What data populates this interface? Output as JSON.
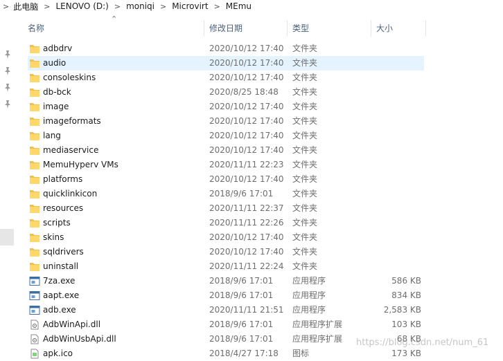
{
  "breadcrumb": {
    "segments": [
      "此电脑",
      "LENOVO (D:)",
      "moniqi",
      "Microvirt",
      "MEmu"
    ],
    "separator": ">"
  },
  "columns": {
    "name": "名称",
    "date": "修改日期",
    "type": "类型",
    "size": "大小"
  },
  "icons": {
    "folder": "folder-icon",
    "exe": "application-icon",
    "dll": "dll-icon",
    "ico": "image-file-icon",
    "pin": "pin-icon",
    "sort": "sort-ascending-icon"
  },
  "colors": {
    "folder": "#f0c04a",
    "selected_row": "#e5f3ff",
    "header_text": "#4c607a"
  },
  "files": [
    {
      "name": "adbdrv",
      "date": "2020/10/12 17:40",
      "type": "文件夹",
      "size": "",
      "kind": "folder"
    },
    {
      "name": "audio",
      "date": "2020/10/12 17:40",
      "type": "文件夹",
      "size": "",
      "kind": "folder",
      "selected": true
    },
    {
      "name": "consoleskins",
      "date": "2020/10/12 17:40",
      "type": "文件夹",
      "size": "",
      "kind": "folder"
    },
    {
      "name": "db-bck",
      "date": "2020/8/25 18:48",
      "type": "文件夹",
      "size": "",
      "kind": "folder"
    },
    {
      "name": "image",
      "date": "2020/10/12 17:40",
      "type": "文件夹",
      "size": "",
      "kind": "folder"
    },
    {
      "name": "imageformats",
      "date": "2020/10/12 17:40",
      "type": "文件夹",
      "size": "",
      "kind": "folder"
    },
    {
      "name": "lang",
      "date": "2020/10/12 17:40",
      "type": "文件夹",
      "size": "",
      "kind": "folder"
    },
    {
      "name": "mediaservice",
      "date": "2020/10/12 17:40",
      "type": "文件夹",
      "size": "",
      "kind": "folder"
    },
    {
      "name": "MemuHyperv VMs",
      "date": "2020/11/11 22:23",
      "type": "文件夹",
      "size": "",
      "kind": "folder"
    },
    {
      "name": "platforms",
      "date": "2020/10/12 17:40",
      "type": "文件夹",
      "size": "",
      "kind": "folder"
    },
    {
      "name": "quicklinkicon",
      "date": "2018/9/6 17:01",
      "type": "文件夹",
      "size": "",
      "kind": "folder"
    },
    {
      "name": "resources",
      "date": "2020/11/11 22:37",
      "type": "文件夹",
      "size": "",
      "kind": "folder"
    },
    {
      "name": "scripts",
      "date": "2020/11/11 22:26",
      "type": "文件夹",
      "size": "",
      "kind": "folder"
    },
    {
      "name": "skins",
      "date": "2020/10/12 17:40",
      "type": "文件夹",
      "size": "",
      "kind": "folder"
    },
    {
      "name": "sqldrivers",
      "date": "2020/10/12 17:40",
      "type": "文件夹",
      "size": "",
      "kind": "folder"
    },
    {
      "name": "uninstall",
      "date": "2020/11/11 22:24",
      "type": "文件夹",
      "size": "",
      "kind": "folder"
    },
    {
      "name": "7za.exe",
      "date": "2018/9/6 17:01",
      "type": "应用程序",
      "size": "586 KB",
      "kind": "exe"
    },
    {
      "name": "aapt.exe",
      "date": "2018/9/6 17:01",
      "type": "应用程序",
      "size": "834 KB",
      "kind": "exe"
    },
    {
      "name": "adb.exe",
      "date": "2020/11/11 21:51",
      "type": "应用程序",
      "size": "2,583 KB",
      "kind": "exe"
    },
    {
      "name": "AdbWinApi.dll",
      "date": "2018/9/6 17:01",
      "type": "应用程序扩展",
      "size": "103 KB",
      "kind": "dll"
    },
    {
      "name": "AdbWinUsbApi.dll",
      "date": "2018/9/6 17:01",
      "type": "应用程序扩展",
      "size": "68 KB",
      "kind": "dll"
    },
    {
      "name": "apk.ico",
      "date": "2018/4/27 17:18",
      "type": "图标",
      "size": "173 KB",
      "kind": "ico"
    }
  ],
  "watermark": "https://blog.csdn.net/num_61"
}
